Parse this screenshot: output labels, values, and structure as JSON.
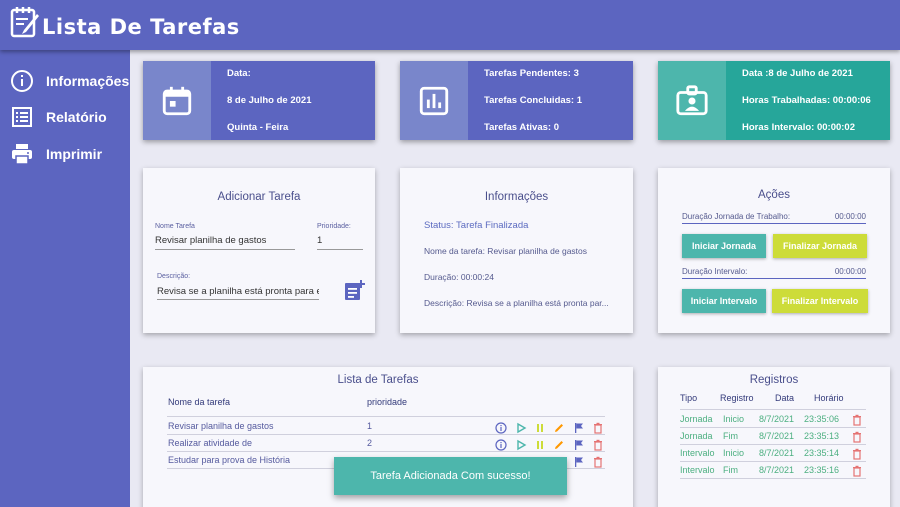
{
  "app": {
    "title": "Lista De Tarefas"
  },
  "sidebar": {
    "items": [
      {
        "label": "Informações",
        "icon": "info-icon"
      },
      {
        "label": "Relatório",
        "icon": "list-icon"
      },
      {
        "label": "Imprimir",
        "icon": "printer-icon"
      }
    ]
  },
  "stats": {
    "date_card": {
      "icon": "calendar-icon",
      "line1": "Data:",
      "line2": "8 de Julho de 2021",
      "line3": "Quinta - Feira"
    },
    "tasks_card": {
      "icon": "bar-chart-icon",
      "line1": "Tarefas Pendentes: 3",
      "line2": "Tarefas Concluidas: 1",
      "line3": "Tarefas Ativas: 0"
    },
    "hours_card": {
      "icon": "id-badge-icon",
      "line1": "Data :8 de Julho de 2021",
      "line2": "Horas Trabalhadas: 00:00:06",
      "line3": "Horas Intervalo: 00:00:02"
    }
  },
  "add_task": {
    "title": "Adicionar Tarefa",
    "name_label": "Nome Tarefa",
    "name_value": "Revisar planilha de gastos",
    "priority_label": "Prioridade:",
    "priority_value": "1",
    "desc_label": "Descrição:",
    "desc_value": "Revisa se a planilha está pronta para er",
    "add_icon": "playlist-add-icon"
  },
  "info": {
    "title": "Informações",
    "status": "Status: Tarefa Finalizada",
    "task_name": "Nome da tarefa: Revisar planilha de gastos",
    "duration": "Duração: 00:00:24",
    "description": "Descrição: Revisa se a planilha está pronta par..."
  },
  "actions": {
    "title": "Ações",
    "work_label": "Duração Jornada de Trabalho:",
    "work_value": "00:00:00",
    "start_work": "Iniciar Jornada",
    "end_work": "Finalizar Jornada",
    "break_label": "Duração Intervalo:",
    "break_value": "00:00:00",
    "start_break": "Iniciar Intervalo",
    "end_break": "Finalizar Intervalo"
  },
  "task_list": {
    "title": "Lista de Tarefas",
    "columns": [
      "Nome da tarefa",
      "prioridade"
    ],
    "rows": [
      {
        "name": "Revisar planilha de gastos",
        "priority": "1"
      },
      {
        "name": "Realizar atividade de",
        "priority": "2"
      },
      {
        "name": "Estudar para prova de História",
        "priority": ""
      }
    ],
    "row_icons": [
      "info-icon",
      "play-icon",
      "pause-icon",
      "edit-icon",
      "flag-icon",
      "trash-icon"
    ]
  },
  "records": {
    "title": "Registros",
    "columns": [
      "Tipo",
      "Registro",
      "Data",
      "Horário"
    ],
    "rows": [
      {
        "tipo": "Jornada",
        "registro": "Inicio",
        "data": "8/7/2021",
        "horario": "23:35:06"
      },
      {
        "tipo": "Jornada",
        "registro": "Fim",
        "data": "8/7/2021",
        "horario": "23:35:13"
      },
      {
        "tipo": "Intervalo",
        "registro": "Inicio",
        "data": "8/7/2021",
        "horario": "23:35:14"
      },
      {
        "tipo": "Intervalo",
        "registro": "Fim",
        "data": "8/7/2021",
        "horario": "23:35:16"
      }
    ]
  },
  "toast": {
    "message": "Tarefa Adicionada Com sucesso!"
  },
  "colors": {
    "primary": "#5c65c0",
    "primary_light": "#7986cb",
    "teal": "#26a69a",
    "teal_light": "#4db6ac",
    "yellow": "#cddc39",
    "green_text": "#4caf80",
    "red_icon": "#e57373"
  }
}
